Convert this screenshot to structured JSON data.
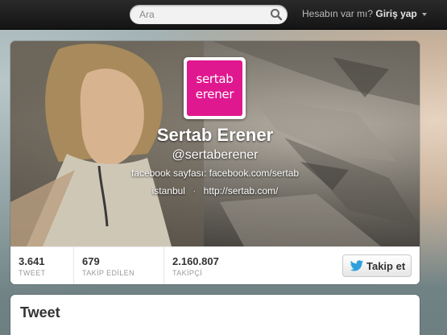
{
  "search": {
    "placeholder": "Ara"
  },
  "login": {
    "prompt": "Hesabın var mı?",
    "link": "Giriş yap"
  },
  "profile": {
    "avatar_line1": "sertab",
    "avatar_line2": "erener",
    "name": "Sertab Erener",
    "handle": "@sertaberener",
    "bio": "facebook sayfası: facebook.com/sertab",
    "location": "istanbul",
    "separator": "·",
    "url": "http://sertab.com/"
  },
  "stats": [
    {
      "value": "3.641",
      "label": "TWEET"
    },
    {
      "value": "679",
      "label": "TAKİP EDİLEN"
    },
    {
      "value": "2.160.807",
      "label": "TAKİPÇİ"
    }
  ],
  "follow_button": {
    "label": "Takip et"
  },
  "tweets": {
    "heading": "Tweet"
  },
  "colors": {
    "avatar_brand": "#e0188f",
    "twitter_blue": "#2fa0db",
    "topbar": "#1e1e1e"
  },
  "icons": [
    "search-icon",
    "caret-down-icon",
    "twitter-bird-icon"
  ]
}
